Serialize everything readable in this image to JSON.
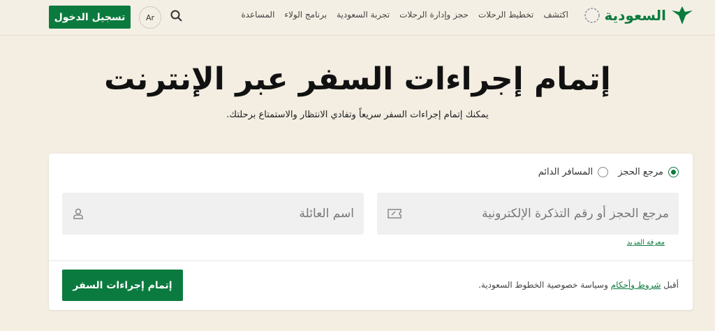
{
  "header": {
    "logo_text": "السعودية",
    "nav": [
      "اكتشف",
      "تخطيط الرحلات",
      "حجز وإدارة الرحلات",
      "تجربة السعودية",
      "برنامج الولاء",
      "المساعدة"
    ],
    "lang": "Ar",
    "login": "تسجيل الدخول"
  },
  "main": {
    "title": "إتمام إجراءات السفر عبر الإنترنت",
    "subtitle": "يمكنك إتمام إجراءات السفر سريعاً وتفادي الانتظار والاستمتاع برحلتك."
  },
  "form": {
    "radios": [
      {
        "label": "مرجع الحجز",
        "selected": true
      },
      {
        "label": "المسافر الدائم",
        "selected": false
      }
    ],
    "booking_placeholder": "مرجع الحجز أو رقم التذكرة الإلكترونية",
    "lastname_placeholder": "اسم العائلة",
    "learn_more": "معرفة المزيد",
    "terms_prefix": "أقبل",
    "terms_link": "شروط وأحكام",
    "terms_suffix": "وسياسة خصوصية الخطوط السعودية.",
    "submit": "إتمام إجراءات السفر"
  },
  "colors": {
    "brand": "#0b7a3e",
    "background": "#f3ede2"
  }
}
